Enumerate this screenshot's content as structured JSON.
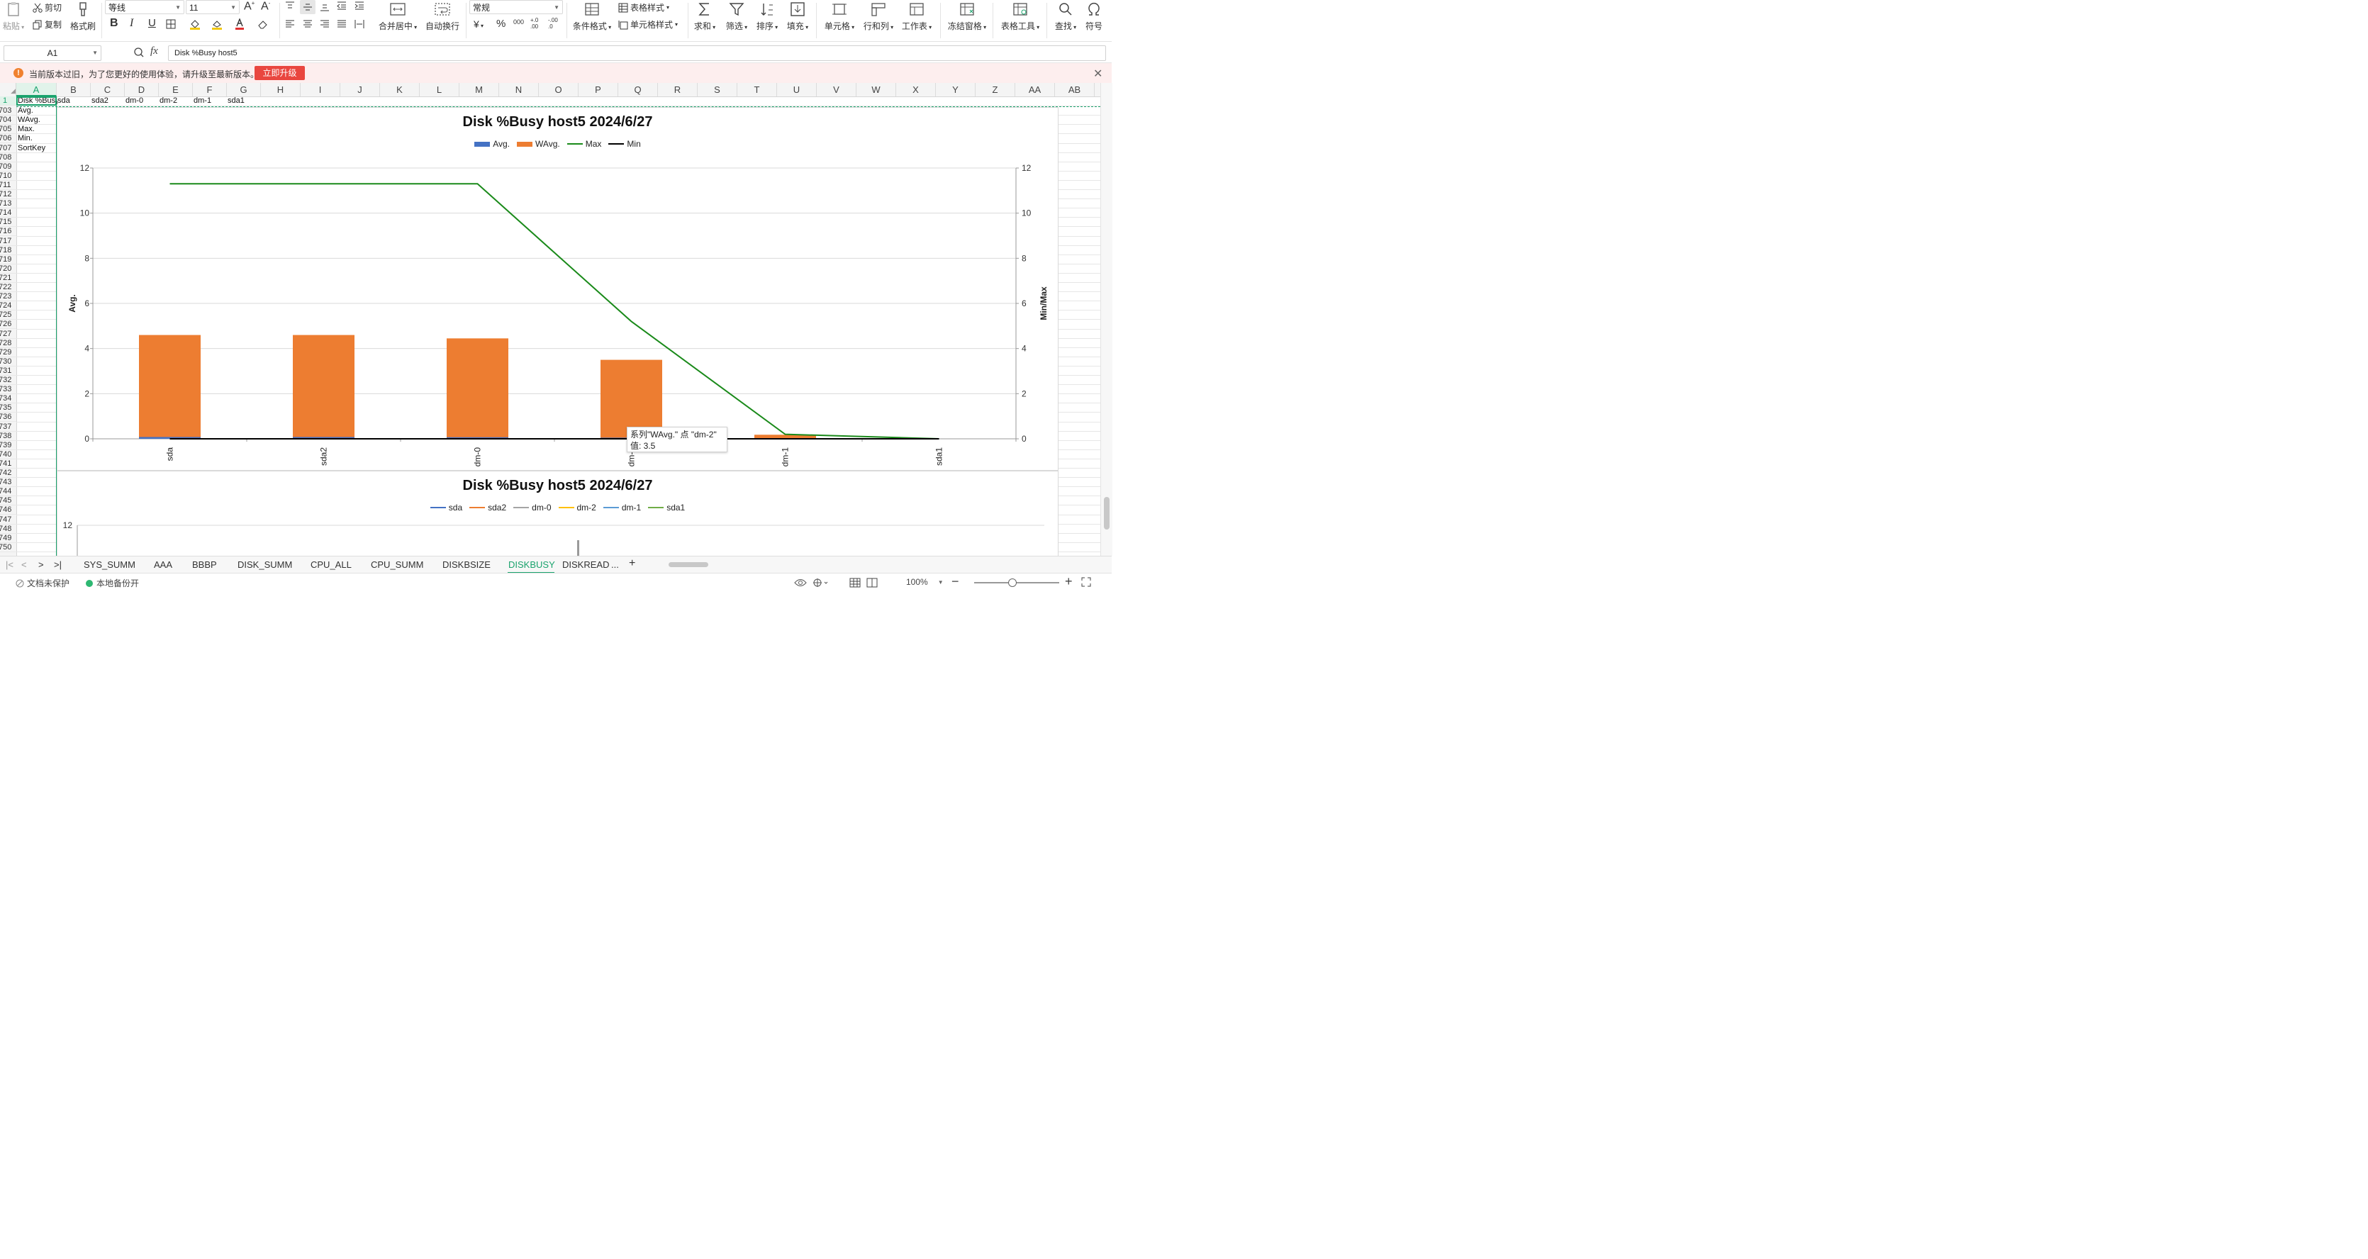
{
  "ribbon": {
    "paste": "粘贴",
    "cut": "剪切",
    "copy": "复制",
    "format_painter": "格式刷",
    "font_name": "等线",
    "font_size": "11",
    "merge_center": "合并居中",
    "wrap_text": "自动换行",
    "number_format": "常规",
    "cond_format": "条件格式",
    "table_style": "表格样式",
    "cell_style": "单元格样式",
    "sum": "求和",
    "filter": "筛选",
    "sort": "排序",
    "fill": "填充",
    "cell": "单元格",
    "row_col": "行和列",
    "worksheet": "工作表",
    "freeze": "冻结窗格",
    "table_tools": "表格工具",
    "find": "查找",
    "symbol": "符号",
    "bold": "B",
    "italic": "I",
    "underline": "U",
    "percent": "%",
    "currency": "¥",
    "thousands": "000",
    "dec_inc": "+.0 .00",
    "dec_dec": "-.00 .0"
  },
  "formula_bar": {
    "name_box": "A1",
    "fx": "fx",
    "formula": "Disk %Busy host5"
  },
  "notice": {
    "text": "当前版本过旧，为了您更好的使用体验，请升级至最新版本。",
    "button": "立即升级",
    "icon": "!"
  },
  "grid": {
    "columns": [
      "A",
      "B",
      "C",
      "D",
      "E",
      "F",
      "G",
      "H",
      "I",
      "J",
      "K",
      "L",
      "M",
      "N",
      "O",
      "P",
      "Q",
      "R",
      "S",
      "T",
      "U",
      "V",
      "W",
      "X",
      "Y",
      "Z",
      "AA",
      "AB"
    ],
    "row1_number": "1",
    "row1_cells": [
      "Disk  %Busy",
      "sda",
      "sda2",
      "dm-0",
      "dm-2",
      "dm-1",
      "sda1"
    ],
    "rows": [
      {
        "n": "703",
        "a": "Avg."
      },
      {
        "n": "704",
        "a": "WAvg."
      },
      {
        "n": "705",
        "a": "Max."
      },
      {
        "n": "706",
        "a": "Min."
      },
      {
        "n": "707",
        "a": "SortKey"
      },
      {
        "n": "708",
        "a": ""
      },
      {
        "n": "709",
        "a": ""
      },
      {
        "n": "710",
        "a": ""
      },
      {
        "n": "711",
        "a": ""
      },
      {
        "n": "712",
        "a": ""
      },
      {
        "n": "713",
        "a": ""
      },
      {
        "n": "714",
        "a": ""
      },
      {
        "n": "715",
        "a": ""
      },
      {
        "n": "716",
        "a": ""
      },
      {
        "n": "717",
        "a": ""
      },
      {
        "n": "718",
        "a": ""
      },
      {
        "n": "719",
        "a": ""
      },
      {
        "n": "720",
        "a": ""
      },
      {
        "n": "721",
        "a": ""
      },
      {
        "n": "722",
        "a": ""
      },
      {
        "n": "723",
        "a": ""
      },
      {
        "n": "724",
        "a": ""
      },
      {
        "n": "725",
        "a": ""
      },
      {
        "n": "726",
        "a": ""
      },
      {
        "n": "727",
        "a": ""
      },
      {
        "n": "728",
        "a": ""
      },
      {
        "n": "729",
        "a": ""
      },
      {
        "n": "730",
        "a": ""
      },
      {
        "n": "731",
        "a": ""
      },
      {
        "n": "732",
        "a": ""
      },
      {
        "n": "733",
        "a": ""
      },
      {
        "n": "734",
        "a": ""
      },
      {
        "n": "735",
        "a": ""
      },
      {
        "n": "736",
        "a": ""
      },
      {
        "n": "737",
        "a": ""
      },
      {
        "n": "738",
        "a": ""
      },
      {
        "n": "739",
        "a": ""
      },
      {
        "n": "740",
        "a": ""
      },
      {
        "n": "741",
        "a": ""
      },
      {
        "n": "742",
        "a": ""
      },
      {
        "n": "743",
        "a": ""
      },
      {
        "n": "744",
        "a": ""
      },
      {
        "n": "745",
        "a": ""
      },
      {
        "n": "746",
        "a": ""
      },
      {
        "n": "747",
        "a": ""
      },
      {
        "n": "748",
        "a": ""
      },
      {
        "n": "749",
        "a": ""
      },
      {
        "n": "750",
        "a": ""
      }
    ]
  },
  "chart_data": [
    {
      "type": "bar",
      "title": "Disk %Busy host5  2024/6/27",
      "categories": [
        "sda",
        "sda2",
        "dm-0",
        "dm-2",
        "dm-1",
        "sda1"
      ],
      "series": [
        {
          "name": "Avg.",
          "kind": "bar",
          "color": "#4472c4",
          "values": [
            0.08,
            0.08,
            0.07,
            0.05,
            0.01,
            0
          ]
        },
        {
          "name": "WAvg.",
          "kind": "bar",
          "color": "#ed7d31",
          "values": [
            4.6,
            4.6,
            4.45,
            3.5,
            0.18,
            0
          ]
        },
        {
          "name": "Max",
          "kind": "line",
          "axis": "secondary",
          "color": "#1a8a1a",
          "values": [
            11.3,
            11.3,
            11.3,
            5.2,
            0.2,
            0
          ]
        },
        {
          "name": "Min",
          "kind": "line",
          "axis": "secondary",
          "color": "#000000",
          "values": [
            0,
            0,
            0,
            0,
            0,
            0
          ]
        }
      ],
      "ylabel": "Avg.",
      "y2label": "Min/Max",
      "ylim": [
        0,
        12
      ],
      "y2lim": [
        0,
        12
      ],
      "yticks": [
        "0",
        "2",
        "4",
        "6",
        "8",
        "10",
        "12"
      ],
      "grid": true,
      "legend": "top",
      "tooltip": {
        "line1": "系列\"WAvg.\" 点 \"dm-2\"",
        "line2": "值: 3.5"
      }
    },
    {
      "type": "line",
      "title": "Disk %Busy host5  2024/6/27",
      "series": [
        {
          "name": "sda",
          "color": "#4472c4"
        },
        {
          "name": "sda2",
          "color": "#ed7d31"
        },
        {
          "name": "dm-0",
          "color": "#a5a5a5"
        },
        {
          "name": "dm-2",
          "color": "#ffc000"
        },
        {
          "name": "dm-1",
          "color": "#5b9bd5"
        },
        {
          "name": "sda1",
          "color": "#70ad47"
        }
      ],
      "visible_ytick": "12",
      "legend": "top"
    }
  ],
  "sheet_tabs": [
    "SYS_SUMM",
    "AAA",
    "BBBP",
    "DISK_SUMM",
    "CPU_ALL",
    "CPU_SUMM",
    "DISKBSIZE",
    "DISKBUSY",
    "DISKREAD"
  ],
  "active_tab": "DISKBUSY",
  "tab_more": "...",
  "tab_add": "+",
  "status": {
    "protect": "文档未保护",
    "backup": "本地备份开",
    "zoom": "100%"
  }
}
